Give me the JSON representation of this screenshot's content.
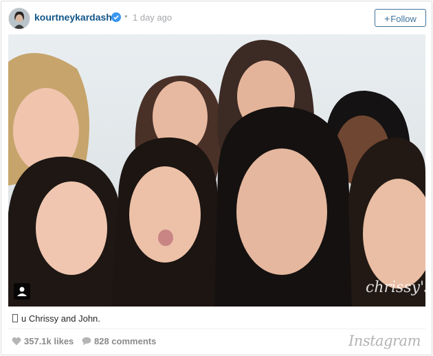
{
  "post": {
    "username": "kourtneykardash",
    "separator": "•",
    "timestamp": "1 day ago",
    "follow_label": "Follow",
    "follow_plus": "+"
  },
  "photo": {
    "watermark": "chrissy's"
  },
  "caption": {
    "text": "u Chrissy and John."
  },
  "stats": {
    "likes": "357.1k likes",
    "comments": "828 comments"
  },
  "brand": {
    "name": "Instagram"
  },
  "icons": {
    "verified": "verified-badge-icon",
    "tag": "person-tag-icon",
    "heart": "heart-icon",
    "comment": "comment-bubble-icon"
  },
  "colors": {
    "username": "#125688",
    "verified": "#3897f0",
    "follow": "#3f729b",
    "muted": "#a5a7aa"
  }
}
